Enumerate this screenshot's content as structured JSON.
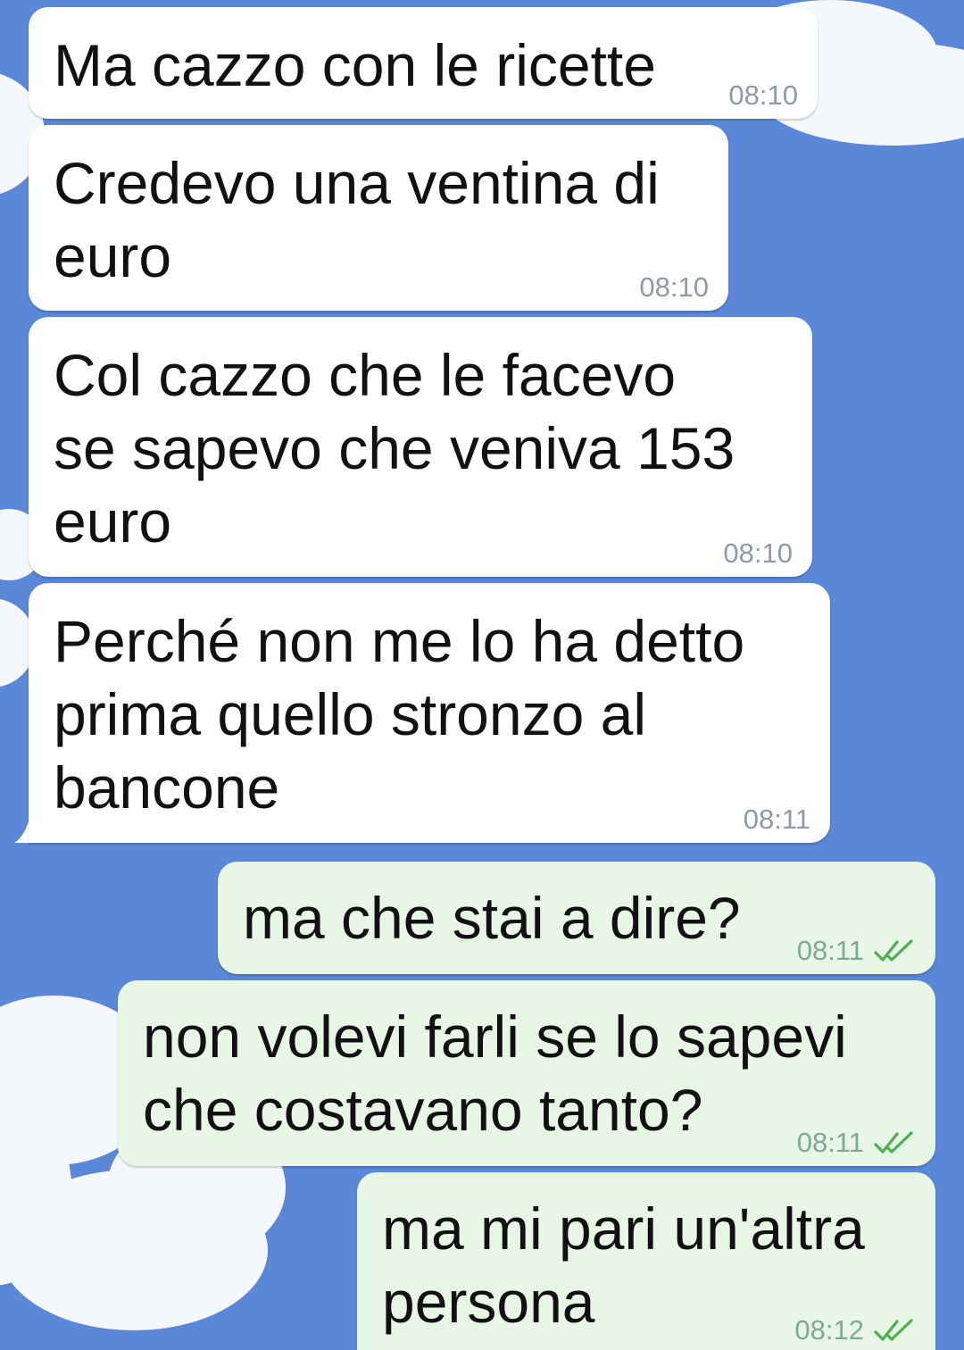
{
  "theme": {
    "wallpaper_color": "#5b87d8",
    "incoming_bubble_color": "#ffffff",
    "outgoing_bubble_color": "#e8f6e6",
    "read_tick_color": "#4caf50"
  },
  "messages": [
    {
      "direction": "in",
      "lines": [
        "Ma cazzo con le ricette"
      ],
      "time": "08:10"
    },
    {
      "direction": "in",
      "lines": [
        "Credevo una ventina di",
        "euro"
      ],
      "time": "08:10"
    },
    {
      "direction": "in",
      "lines": [
        "Col cazzo che le facevo",
        "se sapevo che veniva 153",
        "euro"
      ],
      "time": "08:10"
    },
    {
      "direction": "in",
      "lines": [
        "Perché non me lo ha detto",
        "prima quello stronzo al",
        "bancone"
      ],
      "time": "08:11"
    },
    {
      "direction": "out",
      "lines": [
        "ma che stai a dire?"
      ],
      "time": "08:11",
      "status_icon": "double-check-icon"
    },
    {
      "direction": "out",
      "lines": [
        "non volevi farli se lo sapevi",
        "che costavano tanto?"
      ],
      "time": "08:11",
      "status_icon": "double-check-icon"
    },
    {
      "direction": "out",
      "lines": [
        "ma mi pari un'altra",
        "persona"
      ],
      "time": "08:12",
      "status_icon": "double-check-icon"
    }
  ]
}
